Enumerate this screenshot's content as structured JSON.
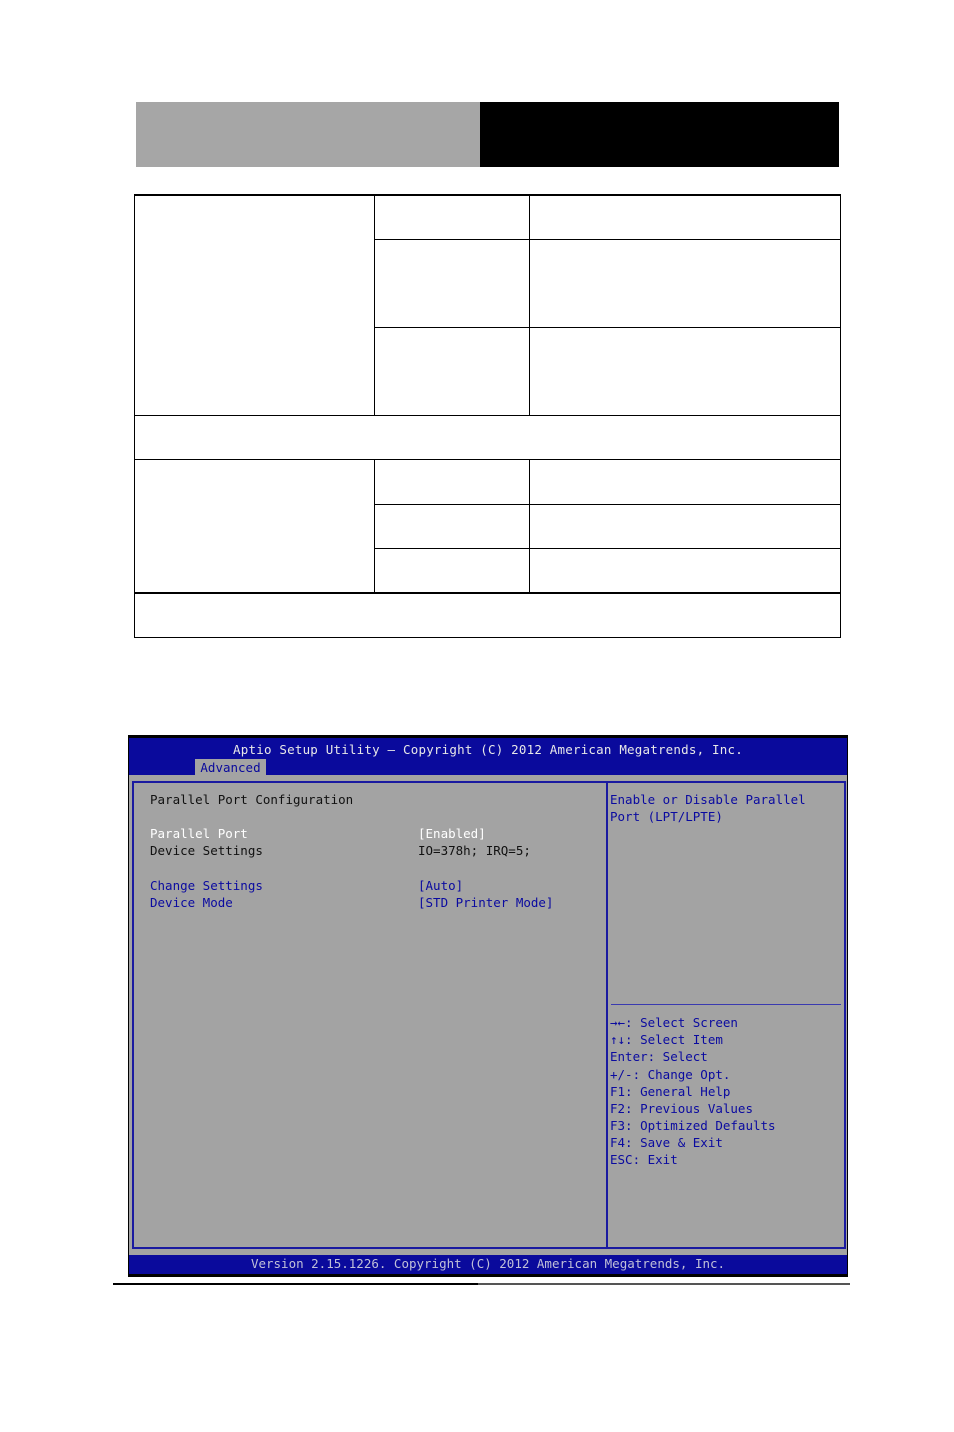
{
  "page_header": {
    "left_block_color": "#a6a6a6",
    "right_block_color": "#000000"
  },
  "document_table": {
    "rows": [
      {
        "cells": [
          "",
          "",
          ""
        ]
      },
      {
        "cells": [
          "",
          ""
        ]
      },
      {
        "cells": [
          "",
          ""
        ]
      },
      {
        "cells": [
          ""
        ]
      },
      {
        "cells": [
          "",
          "",
          ""
        ]
      },
      {
        "cells": [
          "",
          ""
        ]
      },
      {
        "cells": [
          "",
          ""
        ]
      },
      {
        "cells": [
          ""
        ]
      }
    ]
  },
  "bios": {
    "title": "Aptio Setup Utility – Copyright (C) 2012 American Megatrends, Inc.",
    "active_tab": "Advanced",
    "section_title": "Parallel Port Configuration",
    "items": [
      {
        "label": "Parallel Port",
        "value": "[Enabled]",
        "state": "selected"
      },
      {
        "label": "Device Settings",
        "value": "IO=378h; IRQ=5;",
        "state": "readonly"
      },
      {
        "label": "Change Settings",
        "value": "[Auto]",
        "state": "option"
      },
      {
        "label": "Device Mode",
        "value": "[STD Printer Mode]",
        "state": "option"
      }
    ],
    "help_text": [
      "Enable or Disable Parallel",
      "Port (LPT/LPTE)"
    ],
    "key_help": [
      "→←: Select Screen",
      "↑↓: Select Item",
      "Enter: Select",
      "+/-: Change Opt.",
      "F1: General Help",
      "F2: Previous Values",
      "F3: Optimized Defaults",
      "F4: Save & Exit",
      "ESC: Exit"
    ],
    "footer": "Version 2.15.1226. Copyright (C) 2012 American Megatrends, Inc.",
    "colors": {
      "title_bar": "#0a0a9c",
      "body": "#a3a3a3",
      "selected_text": "#ffffff",
      "option_text": "#0a0aa0"
    }
  }
}
